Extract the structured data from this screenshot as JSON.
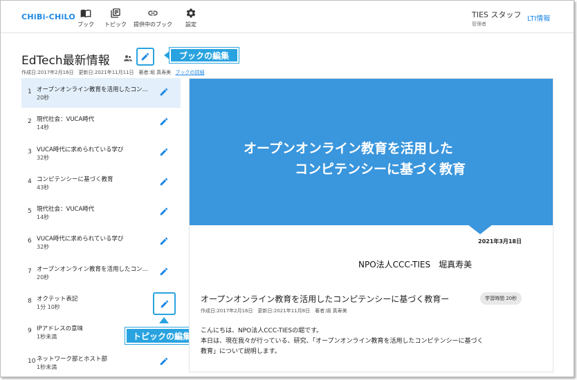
{
  "header": {
    "logo": "CHiBi-CHiLO",
    "nav": [
      {
        "label": "ブック",
        "icon": "book-icon"
      },
      {
        "label": "トピック",
        "icon": "topic-icon"
      },
      {
        "label": "提供中のブック",
        "icon": "link-icon"
      },
      {
        "label": "設定",
        "icon": "gear-icon"
      }
    ],
    "user": {
      "name": "TIES スタッフ",
      "role": "管理者"
    },
    "lti_link": "LTI情報"
  },
  "book": {
    "title": "EdTech最新情報",
    "meta": "作成日:2017年2月16日　更新日:2021年11月11日　著者:堀 真寿美",
    "detail_link": "ブックの詳細"
  },
  "callouts": {
    "book_edit": "ブックの編集",
    "topic_edit": "トピックの編集"
  },
  "topics": [
    {
      "num": "1",
      "title": "オープンオンライン教育を活用したコン…",
      "duration": "20秒",
      "active": true
    },
    {
      "num": "2",
      "title": "現代社会：VUCA時代",
      "duration": "14秒"
    },
    {
      "num": "3",
      "title": "VUCA時代に求められている学び",
      "duration": "32秒"
    },
    {
      "num": "4",
      "title": "コンピテンシーに基づく教育",
      "duration": "43秒"
    },
    {
      "num": "5",
      "title": "現代社会：VUCA時代",
      "duration": "14秒"
    },
    {
      "num": "6",
      "title": "VUCA時代に求められている学び",
      "duration": "32秒"
    },
    {
      "num": "7",
      "title": "オープンオンライン教育を活用したコン…",
      "duration": "20秒"
    },
    {
      "num": "8",
      "title": "オクテット表記",
      "duration": "1分 10秒"
    },
    {
      "num": "9",
      "title": "IPアドレスの意味",
      "duration": "1秒未満"
    },
    {
      "num": "10",
      "title": "ネットワーク部とホスト部",
      "duration": "1秒未満"
    }
  ],
  "slide": {
    "title_line1": "オープンオンライン教育を活用した",
    "title_line2": "コンピテンシーに基づく教育",
    "date": "2021年3月18日",
    "org": "NPO法人CCC-TIES　堀真寿美"
  },
  "content": {
    "heading": "オープンオンライン教育を活用したコンピテンシーに基づく教育ー",
    "chip": "学習時間 20秒",
    "meta": "作成日:2017年2月16日　更新日:2021年11月8日　著者:堀 真寿美",
    "body": [
      "こんにちは、NPO法人CCC-TIESの堀です。",
      "本日は、現在我々が行っている、研究、「オープンオンライン教育を活用したコンピテンシーに基づく",
      "教育」について説明します。"
    ]
  },
  "colors": {
    "accent": "#29a3e0",
    "banner": "#3a96dd",
    "link": "#1e88e5",
    "active_row": "#e3effa"
  }
}
